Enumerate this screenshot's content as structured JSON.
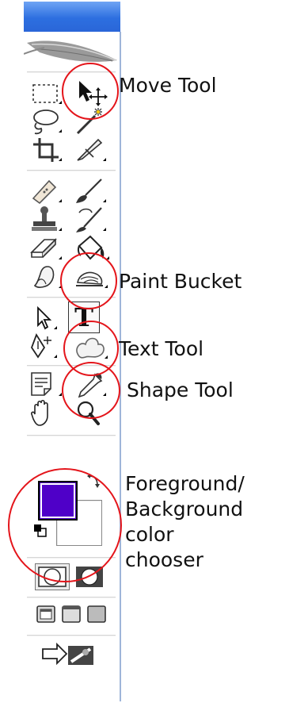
{
  "annotations": {
    "move_tool": "Move Tool",
    "paint_bucket": "Paint Bucket",
    "text_tool": "Text Tool",
    "shape_tool": "Shape Tool",
    "color_chooser": [
      "Foreground/",
      "Background",
      "color",
      "chooser"
    ],
    "circle_color": "#e4151b"
  },
  "tools": {
    "marquee": "marquee-icon",
    "move": "move-icon",
    "lasso": "lasso-icon",
    "magic_wand": "magic-wand-icon",
    "crop": "crop-icon",
    "slice": "slice-icon",
    "healing": "bandage-icon",
    "brush": "brush-icon",
    "stamp": "stamp-icon",
    "history_brush": "history-brush-icon",
    "eraser": "eraser-icon",
    "paint_bucket": "paint-bucket-icon",
    "blur": "blur-icon",
    "dodge": "dodge-icon",
    "path_select": "path-select-icon",
    "type_glyph": "T",
    "pen": "pen-icon",
    "custom_shape": "custom-shape-icon",
    "notes": "notes-icon",
    "eyedropper": "eyedropper-icon",
    "hand": "hand-icon",
    "zoom": "zoom-icon"
  },
  "colors": {
    "foreground": "#4f00c8",
    "background": "#ffffff",
    "titlebar": "#2d6fe0"
  }
}
